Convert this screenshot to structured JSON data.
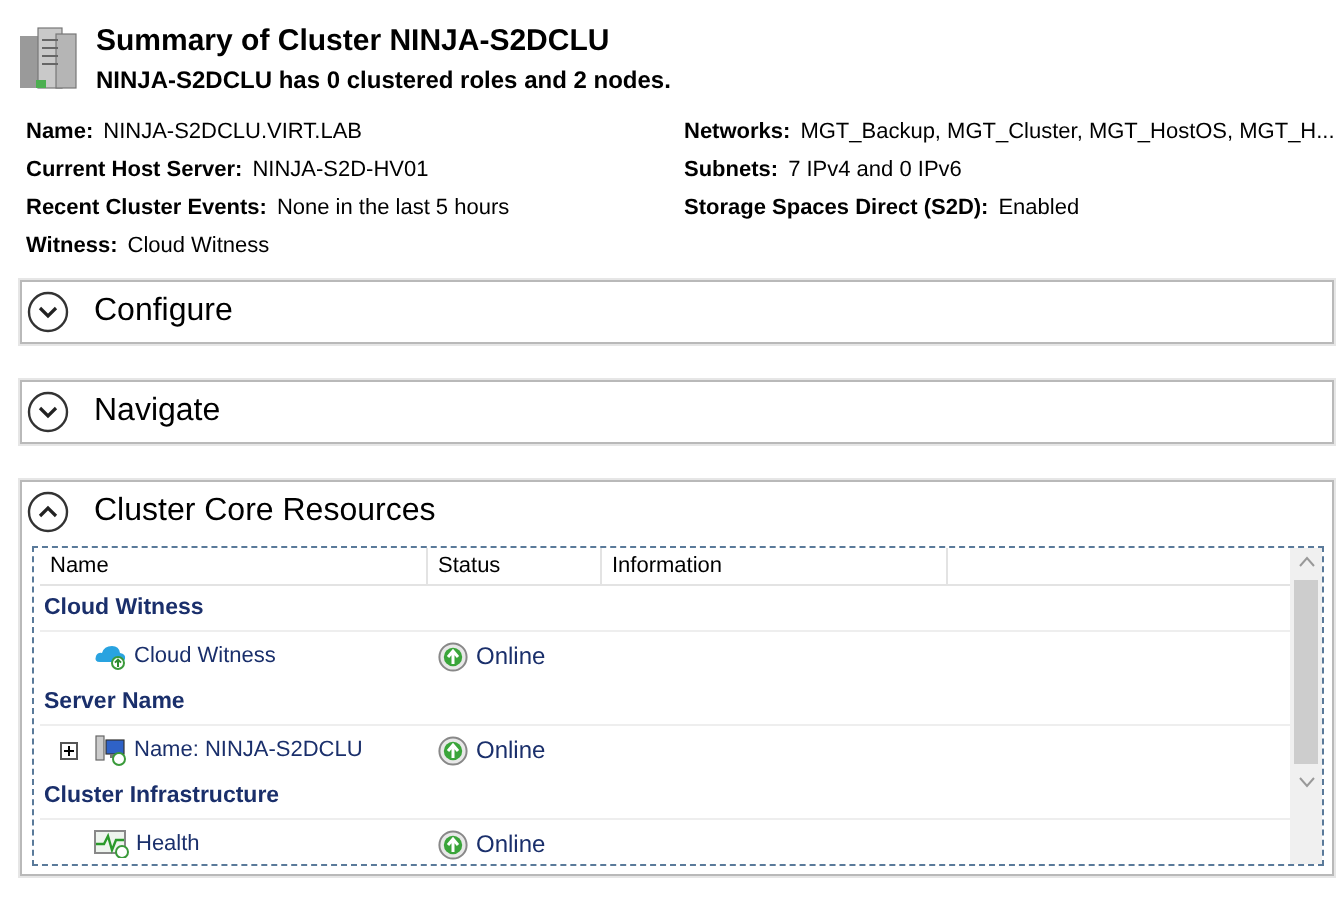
{
  "summary": {
    "title": "Summary of Cluster NINJA-S2DCLU",
    "subtitle": "NINJA-S2DCLU has 0 clustered roles and 2 nodes."
  },
  "details_left": [
    {
      "label": "Name:",
      "value": "NINJA-S2DCLU.VIRT.LAB"
    },
    {
      "label": "Current Host Server:",
      "value": "NINJA-S2D-HV01"
    },
    {
      "label": "Recent Cluster Events:",
      "value": "None in the last 5 hours"
    },
    {
      "label": "Witness:",
      "value": "Cloud Witness"
    }
  ],
  "details_right": [
    {
      "label": "Networks:",
      "value": "MGT_Backup, MGT_Cluster, MGT_HostOS, MGT_H..."
    },
    {
      "label": "Subnets:",
      "value": "7 IPv4 and 0 IPv6"
    },
    {
      "label": "Storage Spaces Direct (S2D):",
      "value": "Enabled"
    }
  ],
  "sections": [
    {
      "title": "Configure",
      "expanded": false
    },
    {
      "title": "Navigate",
      "expanded": false
    },
    {
      "title": "Cluster Core Resources",
      "expanded": true
    }
  ],
  "table": {
    "columns": [
      "Name",
      "Status",
      "Information"
    ],
    "rows": [
      {
        "kind": "group",
        "name": "Cloud Witness"
      },
      {
        "kind": "item",
        "name": "Cloud Witness",
        "status": "Online"
      },
      {
        "kind": "group",
        "name": "Server Name"
      },
      {
        "kind": "item",
        "name": "Name: NINJA-S2DCLU",
        "status": "Online",
        "expanded": false
      },
      {
        "kind": "group",
        "name": "Cluster Infrastructure"
      },
      {
        "kind": "item",
        "name": "Health",
        "status": "Online"
      }
    ]
  }
}
